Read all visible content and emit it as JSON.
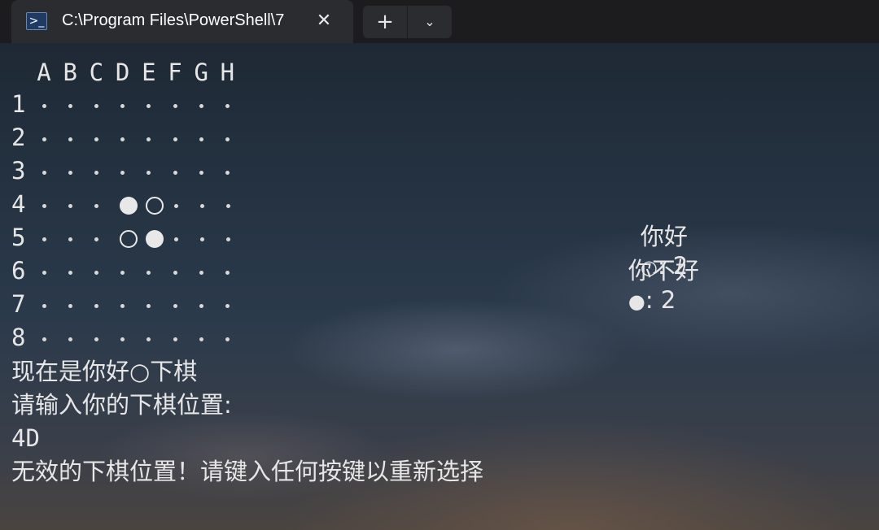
{
  "window": {
    "tab_title": "C:\\Program Files\\PowerShell\\7",
    "tab_icon": "powershell-icon",
    "close_glyph": "✕",
    "new_tab_glyph": "+",
    "dropdown_glyph": "⌄"
  },
  "board": {
    "columns": [
      "A",
      "B",
      "C",
      "D",
      "E",
      "F",
      "G",
      "H"
    ],
    "rows": [
      "1",
      "2",
      "3",
      "4",
      "5",
      "6",
      "7",
      "8"
    ],
    "stones": [
      {
        "cell": "D4",
        "color": "black"
      },
      {
        "cell": "E4",
        "color": "white"
      },
      {
        "cell": "D5",
        "color": "white"
      },
      {
        "cell": "E5",
        "color": "black"
      }
    ]
  },
  "scores": {
    "player1_label": "你好",
    "player1_symbol": "○",
    "player1_score": ": 2",
    "player2_label": "你不好",
    "player2_symbol": "●",
    "player2_score": ": 2"
  },
  "console": {
    "turn_text": "现在是你好○下棋",
    "prompt_text": "请输入你的下棋位置:",
    "input_text": "4D",
    "error_text": "无效的下棋位置！请键入任何按键以重新选择"
  }
}
